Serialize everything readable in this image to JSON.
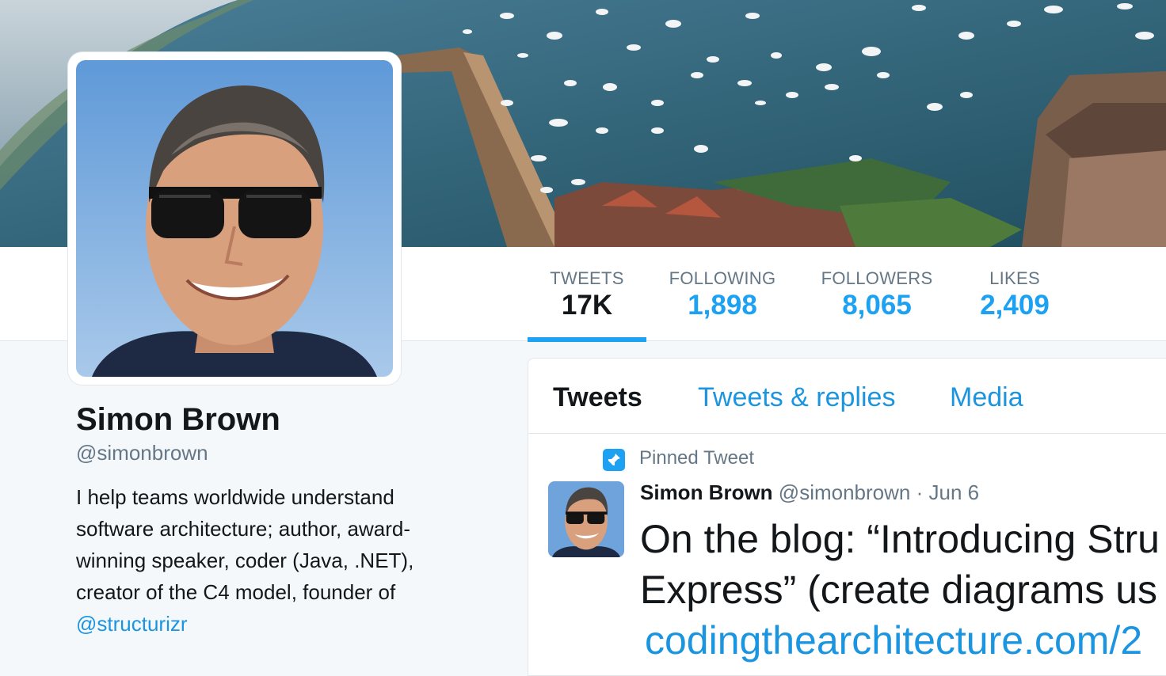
{
  "header": {
    "photo": "harbor-aerial-photo"
  },
  "avatar": {
    "icon": "profile-photo"
  },
  "stats": [
    {
      "label": "TWEETS",
      "value": "17K",
      "active": true
    },
    {
      "label": "FOLLOWING",
      "value": "1,898",
      "active": false
    },
    {
      "label": "FOLLOWERS",
      "value": "8,065",
      "active": false
    },
    {
      "label": "LIKES",
      "value": "2,409",
      "active": false
    }
  ],
  "profile": {
    "name": "Simon Brown",
    "handle": "@simonbrown",
    "bio": "I help teams worldwide understand software architecture; author, award-winning speaker, coder (Java, .NET), creator of the C4 model, founder of",
    "bio_link": "@structurizr"
  },
  "timeline": {
    "tabs": [
      "Tweets",
      "Tweets & replies",
      "Media"
    ],
    "pinned_label": "Pinned Tweet",
    "tweet": {
      "name": "Simon Brown",
      "handle": "@simonbrown",
      "dot": "·",
      "date": "Jun 6",
      "text_line1": "On the blog: “Introducing Stru",
      "text_line2": "Express” (create diagrams us",
      "link": "codingthearchitecture.com/2"
    }
  },
  "colors": {
    "accent": "#1da1f2",
    "link": "#1b95e0",
    "muted": "#657786",
    "text": "#14171a",
    "background": "#f5f8fa"
  }
}
